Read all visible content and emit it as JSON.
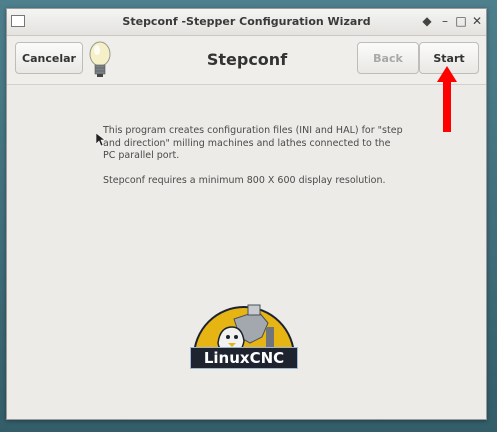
{
  "window": {
    "title": "Stepconf -Stepper Configuration Wizard"
  },
  "titlebar_buttons": {
    "menu": "◆",
    "minimize": "–",
    "maximize": "□",
    "close": "✕"
  },
  "header": {
    "cancel_label": "Cancelar",
    "title": "Stepconf",
    "back_label": "Back",
    "start_label": "Start"
  },
  "content": {
    "paragraph1": "This program creates configuration files (INI and HAL) for \"step and direction\" milling machines and lathes connected to the PC parallel port.",
    "paragraph2": "Stepconf requires a minimum 800 X 600 display resolution."
  },
  "logo": {
    "text": "LinuxCNC"
  },
  "colors": {
    "annotation_arrow": "#ff0000",
    "logo_yellow": "#e6b514",
    "logo_dark": "#1d2430"
  },
  "icons": [
    "lightbulb-icon",
    "mouse-cursor-icon",
    "annotation-arrow-icon",
    "linuxcnc-logo"
  ]
}
